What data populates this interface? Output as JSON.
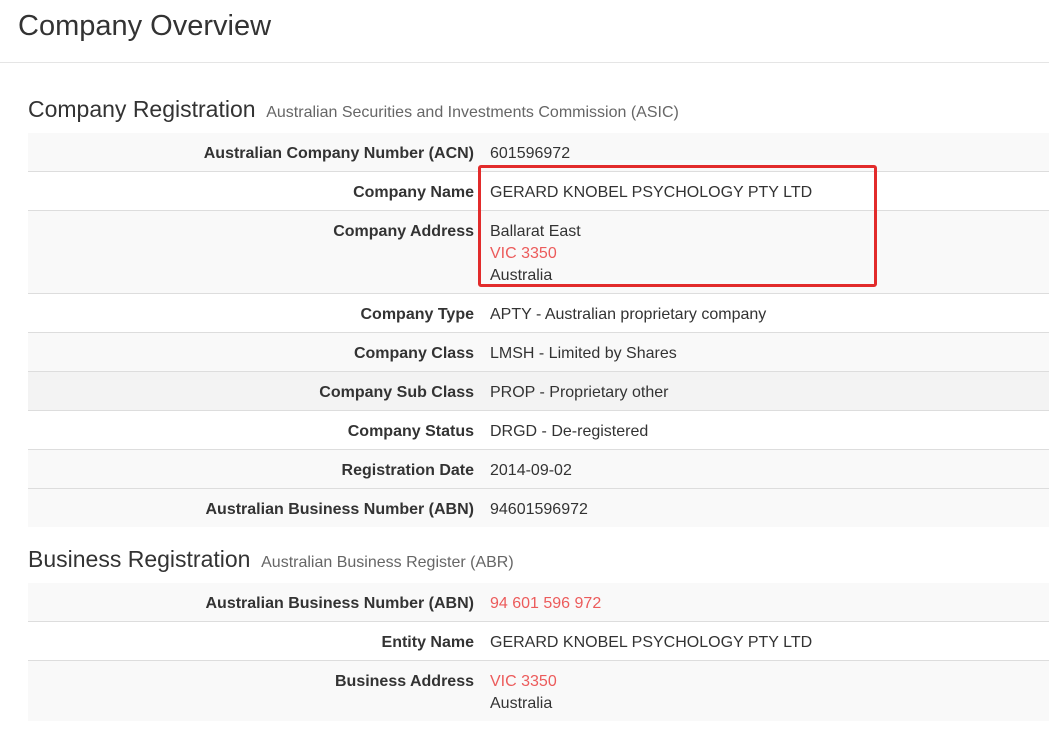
{
  "page": {
    "title": "Company Overview"
  },
  "company_registration": {
    "heading": "Company Registration",
    "subheading": "Australian Securities and Investments Commission (ASIC)",
    "rows": [
      {
        "label": "Australian Company Number (ACN)",
        "value": "601596972"
      },
      {
        "label": "Company Name",
        "value": "GERARD KNOBEL PSYCHOLOGY PTY LTD"
      },
      {
        "label": "Company Address",
        "lines": [
          "Ballarat East",
          "VIC 3350",
          "Australia"
        ]
      },
      {
        "label": "Company Type",
        "value": "APTY - Australian proprietary company"
      },
      {
        "label": "Company Class",
        "value": "LMSH - Limited by Shares"
      },
      {
        "label": "Company Sub Class",
        "value": "PROP - Proprietary other"
      },
      {
        "label": "Company Status",
        "value": "DRGD - De-registered"
      },
      {
        "label": "Registration Date",
        "value": "2014-09-02"
      },
      {
        "label": "Australian Business Number (ABN)",
        "value": "94601596972"
      }
    ]
  },
  "business_registration": {
    "heading": "Business Registration",
    "subheading": "Australian Business Register (ABR)",
    "rows": [
      {
        "label": "Australian Business Number (ABN)",
        "value": "94 601 596 972"
      },
      {
        "label": "Entity Name",
        "value": "GERARD KNOBEL PSYCHOLOGY PTY LTD"
      },
      {
        "label": "Business Address",
        "lines": [
          "VIC 3350",
          "Australia"
        ]
      }
    ]
  },
  "colors": {
    "link": "#ec5b5b",
    "highlight": "#e22b2b",
    "row_stripe": "#f9f9f9"
  }
}
